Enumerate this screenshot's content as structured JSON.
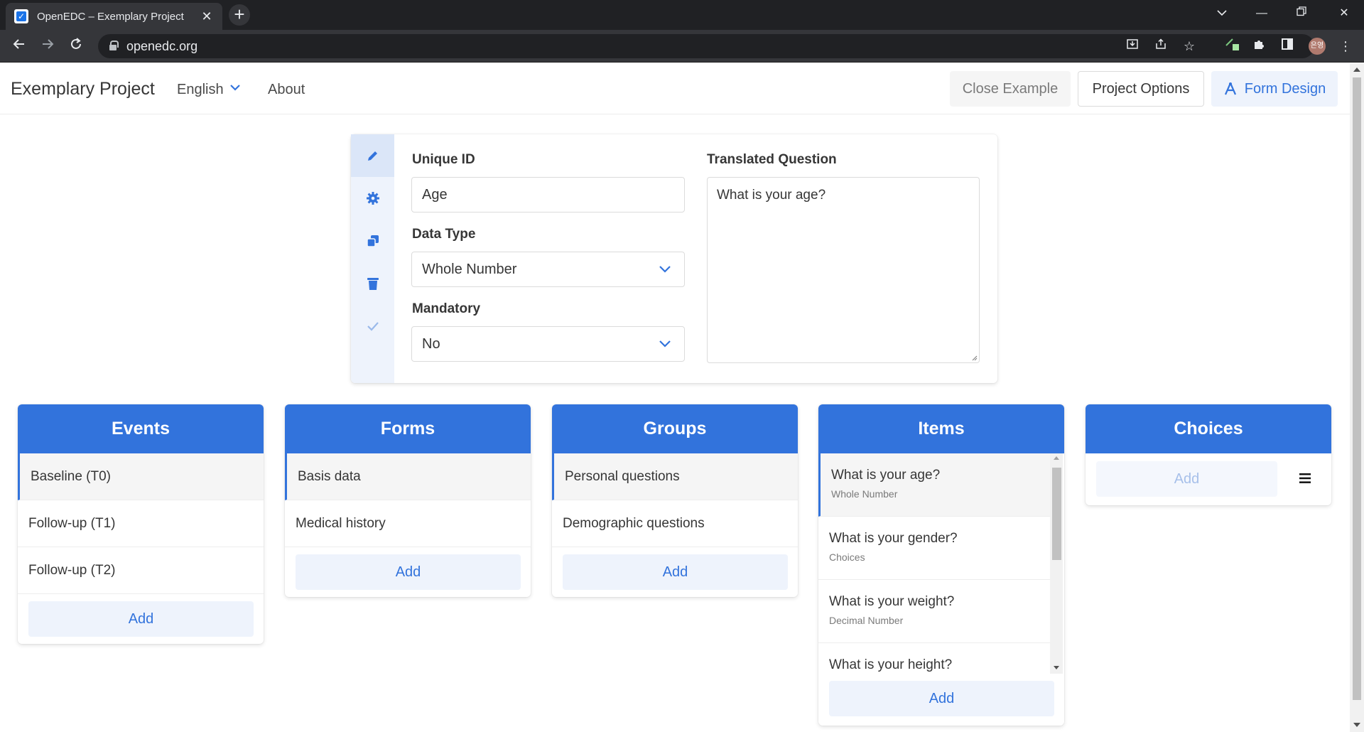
{
  "browser": {
    "tab_title": "OpenEDC – Exemplary Project",
    "url": "openedc.org",
    "profile_initials": "은영"
  },
  "navbar": {
    "project_title": "Exemplary Project",
    "language": "English",
    "about": "About",
    "close_example": "Close Example",
    "project_options": "Project Options",
    "form_design": "Form Design"
  },
  "editor": {
    "unique_id_label": "Unique ID",
    "unique_id_value": "Age",
    "data_type_label": "Data Type",
    "data_type_value": "Whole Number",
    "mandatory_label": "Mandatory",
    "mandatory_value": "No",
    "translated_question_label": "Translated Question",
    "translated_question_value": "What is your age?"
  },
  "columns": {
    "events": {
      "title": "Events",
      "items": [
        "Baseline (T0)",
        "Follow-up (T1)",
        "Follow-up (T2)"
      ],
      "add": "Add"
    },
    "forms": {
      "title": "Forms",
      "items": [
        "Basis data",
        "Medical history"
      ],
      "add": "Add"
    },
    "groups": {
      "title": "Groups",
      "items": [
        "Personal questions",
        "Demographic questions"
      ],
      "add": "Add"
    },
    "items": {
      "title": "Items",
      "items": [
        {
          "question": "What is your age?",
          "type": "Whole Number"
        },
        {
          "question": "What is your gender?",
          "type": "Choices"
        },
        {
          "question": "What is your weight?",
          "type": "Decimal Number"
        },
        {
          "question": "What is your height?",
          "type": ""
        }
      ],
      "add": "Add"
    },
    "choices": {
      "title": "Choices",
      "add": "Add"
    }
  },
  "colors": {
    "primary": "#3273dc",
    "primary_light": "#eef3fc",
    "chrome_dark": "#202124"
  }
}
